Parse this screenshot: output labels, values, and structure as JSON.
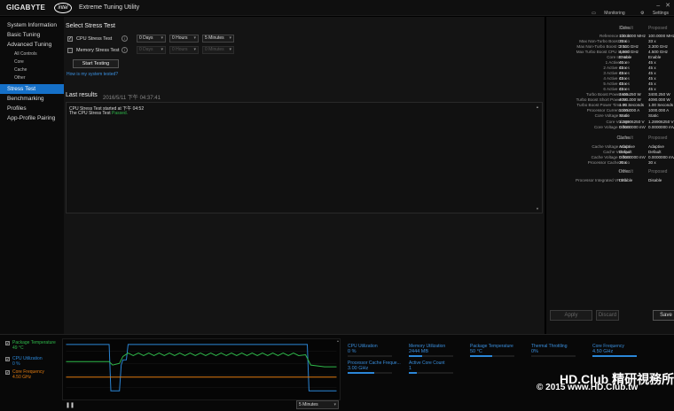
{
  "titlebar": {
    "brand": "GIGABYTE",
    "intel": "intel",
    "app_title": "Extreme Tuning Utility",
    "monitoring": "Monitoring",
    "settings": "Settings"
  },
  "sidebar": {
    "items": [
      {
        "label": "System Information"
      },
      {
        "label": "Basic Tuning"
      },
      {
        "label": "Advanced Tuning"
      },
      {
        "label": "All Controls"
      },
      {
        "label": "Core"
      },
      {
        "label": "Cache"
      },
      {
        "label": "Other"
      },
      {
        "label": "Stress Test"
      },
      {
        "label": "Benchmarking"
      },
      {
        "label": "Profiles"
      },
      {
        "label": "App-Profile Pairing"
      }
    ]
  },
  "main": {
    "title": "Select Stress Test",
    "cpu_test": {
      "label": "CPU Stress Test",
      "days": "0 Days",
      "hours": "0 Hours",
      "minutes": "5 Minutes"
    },
    "mem_test": {
      "label": "Memory Stress Test",
      "days": "0 Days",
      "hours": "0 Hours",
      "minutes": "0 Minutes"
    },
    "start_button": "Start Testing",
    "how_link": "How is my system tested?",
    "last_results": "Last results",
    "last_results_ts": "2016/5/11 下午 04:37:41",
    "log_line1": "CPU Stress Test started at 下午 04:52",
    "log_line2_prefix": "The CPU Stress Test ",
    "log_line2_status": "Passed.",
    "scroll_up": "▲",
    "scroll_down": "▼"
  },
  "right_panel": {
    "col_current": "Default",
    "col_proposed": "Proposed",
    "sections": [
      {
        "label": "Core",
        "current": "Default",
        "proposed": "Proposed",
        "section": true
      },
      {
        "label": "Reference Clock",
        "current": "100.0000 MHz",
        "proposed": "100.0000 MHz"
      },
      {
        "label": "Max Non-Turbo Boost Ratio",
        "current": "33 x",
        "proposed": "33 x"
      },
      {
        "label": "Max Non-Turbo Boost CPU...",
        "current": "3.300 GHz",
        "proposed": "3.300 GHz"
      },
      {
        "label": "Max Turbo Boost CPU Speed",
        "current": "4.500 GHz",
        "proposed": "4.500 GHz"
      },
      {
        "label": "Core IccMax",
        "current": "Enable",
        "proposed": "Enable"
      },
      {
        "label": "1 Active Core",
        "current": "45 x",
        "proposed": "45 x"
      },
      {
        "label": "2 Active Cores",
        "current": "45 x",
        "proposed": "45 x"
      },
      {
        "label": "3 Active Cores",
        "current": "45 x",
        "proposed": "45 x"
      },
      {
        "label": "4 Active Cores",
        "current": "45 x",
        "proposed": "45 x"
      },
      {
        "label": "5 Active Cores",
        "current": "45 x",
        "proposed": "45 x"
      },
      {
        "label": "6 Active Cores",
        "current": "45 x",
        "proposed": "45 x"
      },
      {
        "label": "Turbo Boost Power Max",
        "current": "3400.250 W",
        "proposed": "3400.250 W"
      },
      {
        "label": "Turbo Boost Short Power M...",
        "current": "4090.000 W",
        "proposed": "4090.000 W"
      },
      {
        "label": "Turbo Boost Power Time W...",
        "current": "1.00 Seconds",
        "proposed": "1.00 Seconds"
      },
      {
        "label": "Processor Current Limit",
        "current": "1000.000 A",
        "proposed": "1000.000 A"
      },
      {
        "label": "Core Voltage Mode",
        "current": "Static",
        "proposed": "Static"
      },
      {
        "label": "Core Voltage",
        "current": "1.28906250 V",
        "proposed": "1.28906250 V"
      },
      {
        "label": "Core Voltage Offset",
        "current": "0.0000000 mV",
        "proposed": "0.0000000 mV"
      },
      {
        "label": "Cache",
        "current": "Default",
        "proposed": "Proposed",
        "section": true
      },
      {
        "label": "Cache Voltage Mode",
        "current": "Adaptive",
        "proposed": "Adaptive"
      },
      {
        "label": "Cache Voltage",
        "current": "Default",
        "proposed": "Default"
      },
      {
        "label": "Cache Voltage Offset",
        "current": "0.0000000 mV",
        "proposed": "0.0000000 mV"
      },
      {
        "label": "Processor Cache Ratio",
        "current": "30 x",
        "proposed": "30 x"
      },
      {
        "label": "Other",
        "current": "Default",
        "proposed": "Proposed",
        "section": true
      },
      {
        "label": "Processor Integrated VR Eff...",
        "current": "Disable",
        "proposed": "Disable"
      }
    ],
    "apply": "Apply",
    "discard": "Discard",
    "save": "Save"
  },
  "monitor": {
    "legend": [
      {
        "name": "Package Temperature",
        "value": "49 °C",
        "color": "#2fb84a"
      },
      {
        "name": "CPU Utilization",
        "value": "0 %",
        "color": "#2b87d8"
      },
      {
        "name": "Core Frequency",
        "value": "4.50 GHz",
        "color": "#e07a10"
      }
    ],
    "interval": "5 Minutes",
    "pause_icon": "pause-icon",
    "metrics": [
      {
        "name": "CPU Utilization",
        "value": "0 %",
        "fill": 0.0
      },
      {
        "name": "Memory Utilization",
        "value": "2444 MB",
        "fill": 0.3
      },
      {
        "name": "Package Temperature",
        "value": "50 °C",
        "fill": 0.5
      },
      {
        "name": "Thermal Throttling",
        "value": "0%",
        "fill": 0.0
      },
      {
        "name": "Core Frequency",
        "value": "4.50 GHz",
        "fill": 1.0
      },
      {
        "name": "Processor Cache Freque...",
        "value": "3.00 GHz",
        "fill": 0.6
      },
      {
        "name": "Active Core Count",
        "value": "1",
        "fill": 0.17
      }
    ]
  },
  "watermark": {
    "line1": "HD.Club 精研視務所",
    "line2": "© 2015  www.HD.Club.tw"
  },
  "colors": {
    "accent": "#1570c8",
    "temp": "#2fb84a",
    "util": "#2b87d8",
    "freq": "#e07a10"
  }
}
